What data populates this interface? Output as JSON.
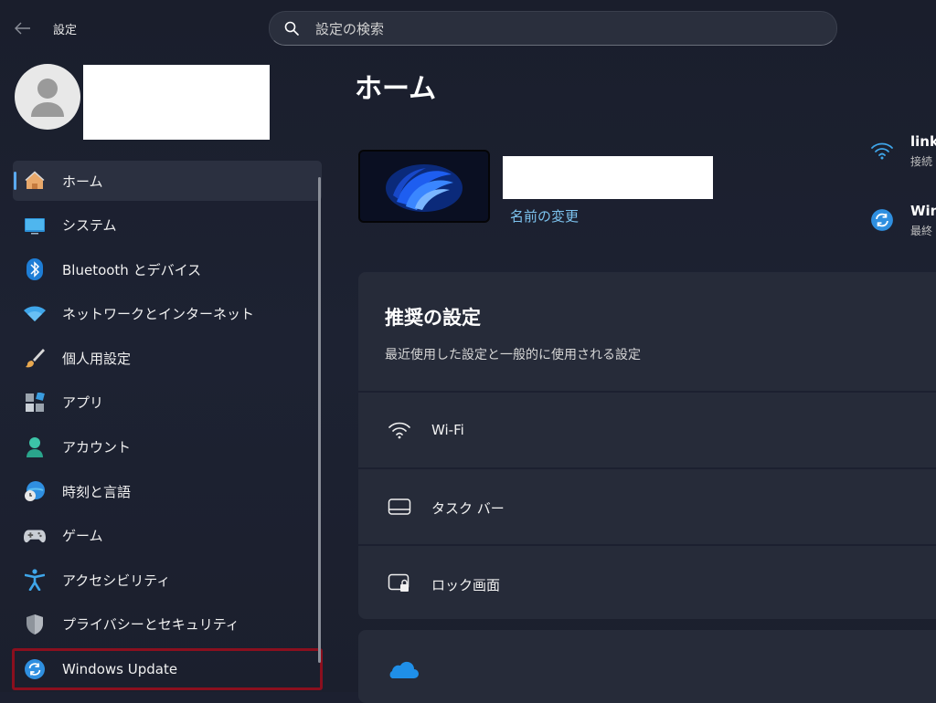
{
  "window": {
    "title": "設定"
  },
  "search": {
    "placeholder": "設定の検索",
    "value": ""
  },
  "sidebar": {
    "items": [
      {
        "label": "ホーム",
        "icon": "home-icon",
        "selected": true
      },
      {
        "label": "システム",
        "icon": "monitor-icon"
      },
      {
        "label": "Bluetooth とデバイス",
        "icon": "bluetooth-icon"
      },
      {
        "label": "ネットワークとインターネット",
        "icon": "wifi-icon"
      },
      {
        "label": "個人用設定",
        "icon": "brush-icon"
      },
      {
        "label": "アプリ",
        "icon": "apps-icon"
      },
      {
        "label": "アカウント",
        "icon": "account-icon"
      },
      {
        "label": "時刻と言語",
        "icon": "globe-clock-icon"
      },
      {
        "label": "ゲーム",
        "icon": "gamepad-icon"
      },
      {
        "label": "アクセシビリティ",
        "icon": "accessibility-icon"
      },
      {
        "label": "プライバシーとセキュリティ",
        "icon": "shield-icon"
      },
      {
        "label": "Windows Update",
        "icon": "update-icon",
        "highlighted": true
      }
    ]
  },
  "main": {
    "title": "ホーム",
    "device": {
      "rename_label": "名前の変更"
    },
    "status": [
      {
        "title": "link",
        "subtitle": "接続",
        "icon": "wifi-icon"
      },
      {
        "title": "Win",
        "subtitle": "最終",
        "icon": "update-icon"
      }
    ],
    "recommended": {
      "title": "推奨の設定",
      "subtitle": "最近使用した設定と一般的に使用される設定",
      "items": [
        {
          "label": "Wi-Fi",
          "icon": "wifi-icon"
        },
        {
          "label": "タスク バー",
          "icon": "taskbar-icon"
        },
        {
          "label": "ロック画面",
          "icon": "lock-screen-icon"
        }
      ]
    },
    "cloud_card": {
      "icon": "onedrive-cloud-icon"
    }
  },
  "colors": {
    "accent": "#5aa9f0",
    "link": "#7cc2ee",
    "background": "#1c2030",
    "card": "#262b39",
    "highlight_box": "#8b0f1e"
  }
}
